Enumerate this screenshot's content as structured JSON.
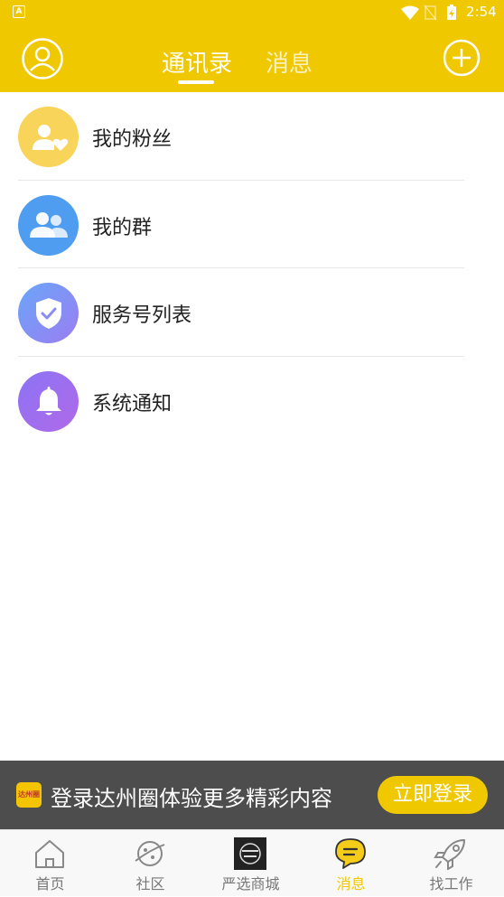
{
  "status_bar": {
    "time": "2:54",
    "notification_icon": "A"
  },
  "header": {
    "tabs": [
      {
        "label": "通讯录",
        "active": true
      },
      {
        "label": "消息",
        "active": false
      }
    ],
    "left_icon": "user-profile-icon",
    "right_icon": "add-circle-icon",
    "bg_color": "#f0c800"
  },
  "contacts": [
    {
      "label": "我的粉丝",
      "icon": "fans-icon",
      "color": "#f9d45a"
    },
    {
      "label": "我的群",
      "icon": "group-icon",
      "color": "#4f9df0"
    },
    {
      "label": "服务号列表",
      "icon": "shield-check-icon",
      "color": "#7c8ef5"
    },
    {
      "label": "系统通知",
      "icon": "bell-icon",
      "color": "#9d6ff0"
    }
  ],
  "login_banner": {
    "logo_text": "达州圈",
    "text": "登录达州圈体验更多精彩内容",
    "button_label": "立即登录"
  },
  "bottom_nav": [
    {
      "label": "首页",
      "icon": "home-icon",
      "active": false
    },
    {
      "label": "社区",
      "icon": "planet-icon",
      "active": false
    },
    {
      "label": "严选商城",
      "icon": "mall-logo-icon",
      "active": false
    },
    {
      "label": "消息",
      "icon": "message-bubble-icon",
      "active": true
    },
    {
      "label": "找工作",
      "icon": "rocket-icon",
      "active": false
    }
  ]
}
